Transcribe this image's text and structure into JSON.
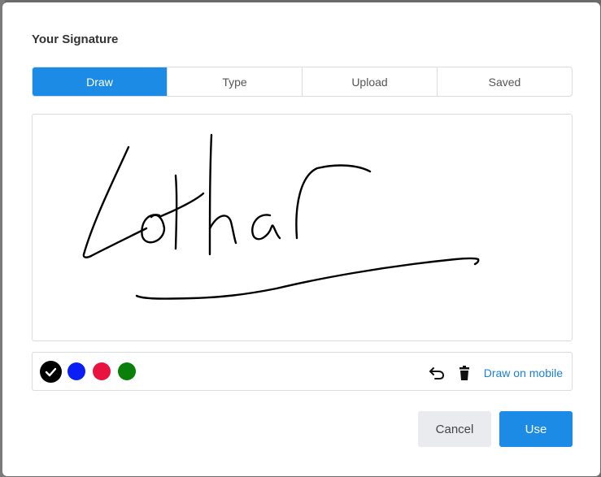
{
  "dialog": {
    "title": "Your Signature"
  },
  "tabs": [
    {
      "label": "Draw",
      "active": true
    },
    {
      "label": "Type",
      "active": false
    },
    {
      "label": "Upload",
      "active": false
    },
    {
      "label": "Saved",
      "active": false
    }
  ],
  "colors": {
    "accent": "#1b8be6",
    "ink": "#000000",
    "swatches": [
      "#000000",
      "#0a1ff5",
      "#e8133f",
      "#0a7f0a"
    ]
  },
  "toolbar": {
    "undo_icon": "undo-icon",
    "delete_icon": "trash-icon",
    "draw_on_mobile_label": "Draw on mobile"
  },
  "actions": {
    "cancel_label": "Cancel",
    "use_label": "Use"
  }
}
